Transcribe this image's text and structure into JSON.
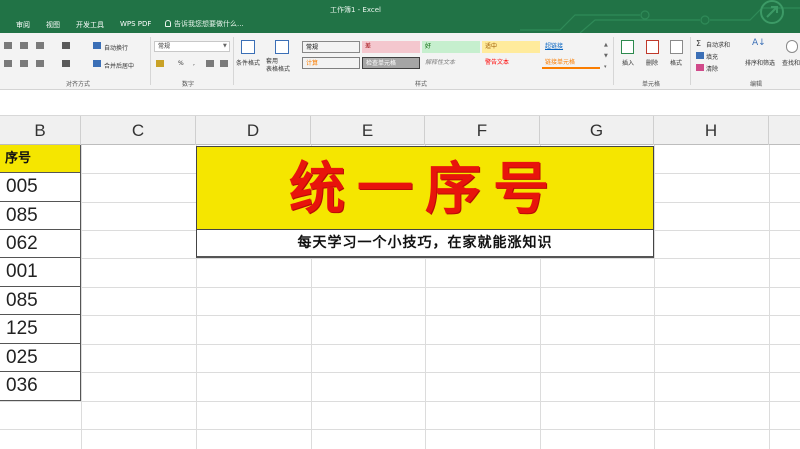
{
  "window": {
    "title": "工作簿1 - Excel"
  },
  "tabs": [
    "审阅",
    "视图",
    "开发工具",
    "WPS PDF"
  ],
  "tell_me": "告诉我您想要做什么...",
  "ribbon": {
    "alignment": {
      "wrap_text": "自动换行",
      "merge_center": "合并后居中",
      "group_label": "对齐方式"
    },
    "number": {
      "format": "常规",
      "group_label": "数字",
      "percent": "%",
      "comma": ","
    },
    "styles": {
      "conditional_format": "条件格式",
      "format_as_table": "套用\n表格格式",
      "group_label": "样式",
      "cells": [
        {
          "label": "常规",
          "color": "#ffffff",
          "text_color": "#333333"
        },
        {
          "label": "差",
          "color": "#f4c7ce",
          "text_color": "#9c0006"
        },
        {
          "label": "好",
          "color": "#c6efce",
          "text_color": "#006100"
        },
        {
          "label": "适中",
          "color": "#ffeb9c",
          "text_color": "#9c5700"
        },
        {
          "label": "超链接",
          "color": "#f3f3f3",
          "text_color": "#0563c1"
        },
        {
          "label": "计算",
          "color": "#f2f2f2",
          "text_color": "#fa7d00"
        },
        {
          "label": "检查单元格",
          "color": "#a5a5a5",
          "text_color": "#ffffff"
        },
        {
          "label": "解释性文本",
          "color": "#f3f3f3",
          "text_color": "#7f7f7f"
        },
        {
          "label": "警告文本",
          "color": "#f3f3f3",
          "text_color": "#ff0000"
        },
        {
          "label": "链接单元格",
          "color": "#f3f3f3",
          "text_color": "#fa7d00"
        }
      ]
    },
    "cells_group": {
      "insert": "插入",
      "delete": "删除",
      "format": "格式",
      "group_label": "单元格"
    },
    "editing": {
      "autosum": "自动求和",
      "fill": "填充",
      "clear": "清除",
      "sort_filter": "排序和筛选",
      "find_select": "查找和选择",
      "group_label": "编辑"
    }
  },
  "columns": [
    "B",
    "C",
    "D",
    "E",
    "F",
    "G",
    "H"
  ],
  "sheet": {
    "b_header": "序号",
    "b_values": [
      "005",
      "085",
      "062",
      "001",
      "085",
      "125",
      "025",
      "036"
    ],
    "title": "统一序号",
    "subtitle": "每天学习一个小技巧，在家就能涨知识"
  },
  "colors": {
    "excel_green": "#217346",
    "highlight_yellow": "#f5e600",
    "title_red": "#e8140c"
  }
}
